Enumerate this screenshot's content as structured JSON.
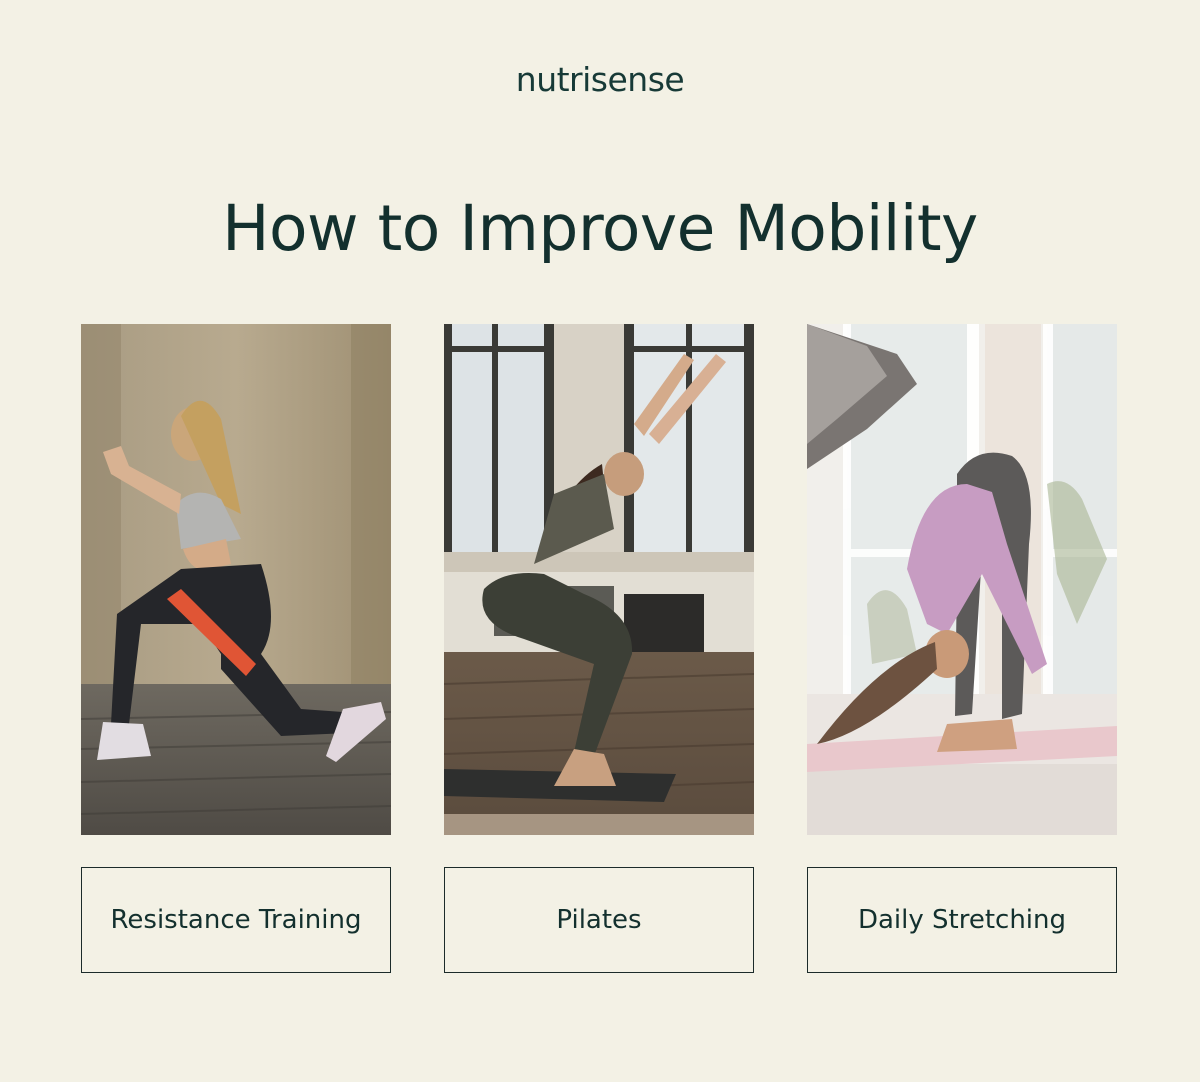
{
  "brand": {
    "logo_text": "nutrisense"
  },
  "heading": {
    "title": "How to Improve Mobility"
  },
  "cards": [
    {
      "label": "Resistance Training",
      "photo": "woman doing lunge with resistance band outdoors"
    },
    {
      "label": "Pilates",
      "photo": "woman in chair pose on yoga mat by windows"
    },
    {
      "label": "Daily Stretching",
      "photo": "woman in standing forward fold on pink mat"
    }
  ],
  "colors": {
    "background": "#f3f1e5",
    "text": "#13302e",
    "border": "#1b2b2a"
  }
}
